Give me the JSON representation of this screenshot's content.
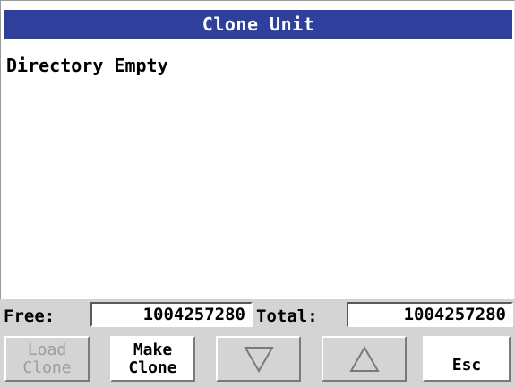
{
  "window": {
    "title": "Clone Unit"
  },
  "directory": {
    "status_text": "Directory Empty"
  },
  "status": {
    "free_label": "Free:",
    "free_value": "1004257280",
    "total_label": "Total:",
    "total_value": "1004257280"
  },
  "buttons": {
    "load_clone": "Load\nClone",
    "make_clone": "Make\nClone",
    "scroll_down": "chevron-down-icon",
    "scroll_up": "chevron-up-icon",
    "esc": "Esc"
  },
  "colors": {
    "titlebar": "#2f3f9c",
    "panel": "#d4d4d4",
    "disabled_text": "#9c9c9c"
  }
}
